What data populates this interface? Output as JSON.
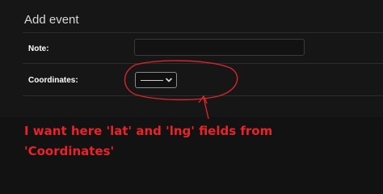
{
  "dialog": {
    "title": "Add event",
    "note_label": "Note:",
    "coordinates_label": "Coordinates:",
    "coordinates_selected": "——",
    "select_icon": "chevron-down-icon"
  },
  "annotation": {
    "color": "#e8232a",
    "line1": "I want here 'lat' and 'lng' fields from",
    "line2": "'Coordinates'"
  }
}
